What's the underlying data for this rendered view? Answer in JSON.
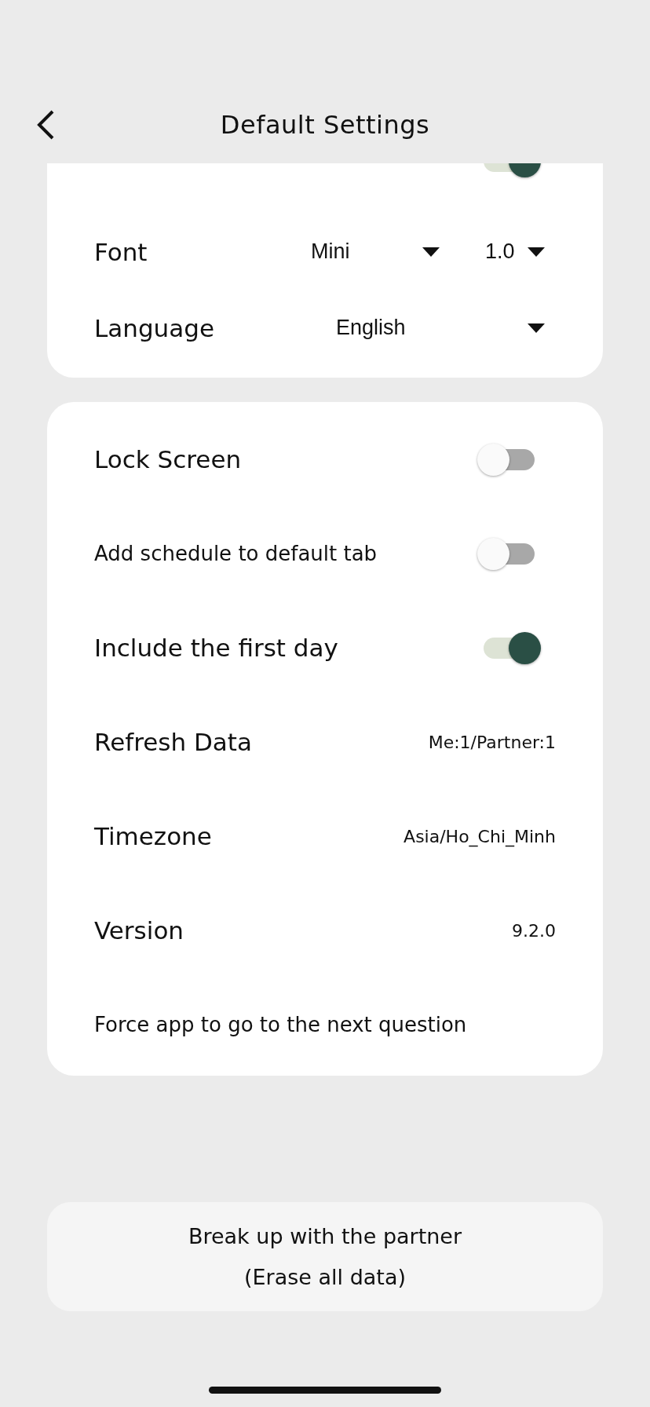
{
  "header": {
    "title": "Default Settings"
  },
  "display_card": {
    "rows": [
      {
        "kind": "toggle",
        "on": true
      },
      {
        "kind": "dual_select",
        "label": "Font",
        "selects": [
          "Mini",
          "1.0"
        ]
      },
      {
        "kind": "select",
        "label": "Language",
        "value": "English"
      }
    ]
  },
  "general_card": {
    "rows": [
      {
        "kind": "toggle",
        "label": "Lock Screen",
        "on": false
      },
      {
        "kind": "toggle",
        "label": "Add schedule to default tab",
        "on": false
      },
      {
        "kind": "toggle",
        "label": "Include the first day",
        "on": true
      },
      {
        "kind": "value",
        "label": "Refresh Data",
        "value": "Me:1/Partner:1"
      },
      {
        "kind": "value",
        "label": "Timezone",
        "value": "Asia/Ho_Chi_Minh"
      },
      {
        "kind": "value",
        "label": "Version",
        "value": "9.2.0"
      },
      {
        "kind": "link",
        "label": "Force app to go to the next question"
      }
    ]
  },
  "erase_button": {
    "lines": [
      "Break up with the partner",
      "(Erase all data)"
    ]
  }
}
